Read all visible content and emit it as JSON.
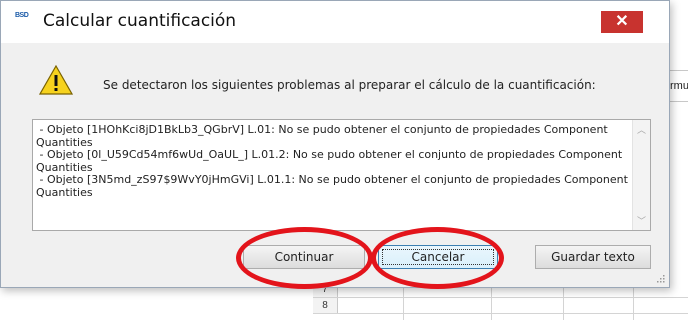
{
  "background": {
    "side_label": "rmu",
    "row_numbers": [
      "7",
      "8"
    ]
  },
  "dialog": {
    "title": "Calcular cuantificación",
    "app_icon_text": "BSD",
    "close_label": "✕",
    "message": "Se detectaron los siguientes problemas al preparar el cálculo de la cuantificación:",
    "details": " - Objeto [1HOhKci8jD1BkLb3_QGbrV] L.01: No se pudo obtener el conjunto de propiedades Component\nQuantities\n - Objeto [0l_U59Cd54mf6wUd_OaUL_] L.01.2: No se pudo obtener el conjunto de propiedades Component\nQuantities\n - Objeto [3N5md_zS97$9WvY0jHmGVi] L.01.1: No se pudo obtener el conjunto de propiedades Component\nQuantities",
    "buttons": {
      "continue": "Continuar",
      "cancel": "Cancelar",
      "save_text": "Guardar texto"
    }
  },
  "colors": {
    "close_button": "#c8332f",
    "annotation": "#e3141b",
    "dialog_bg": "#f0f0f0"
  }
}
